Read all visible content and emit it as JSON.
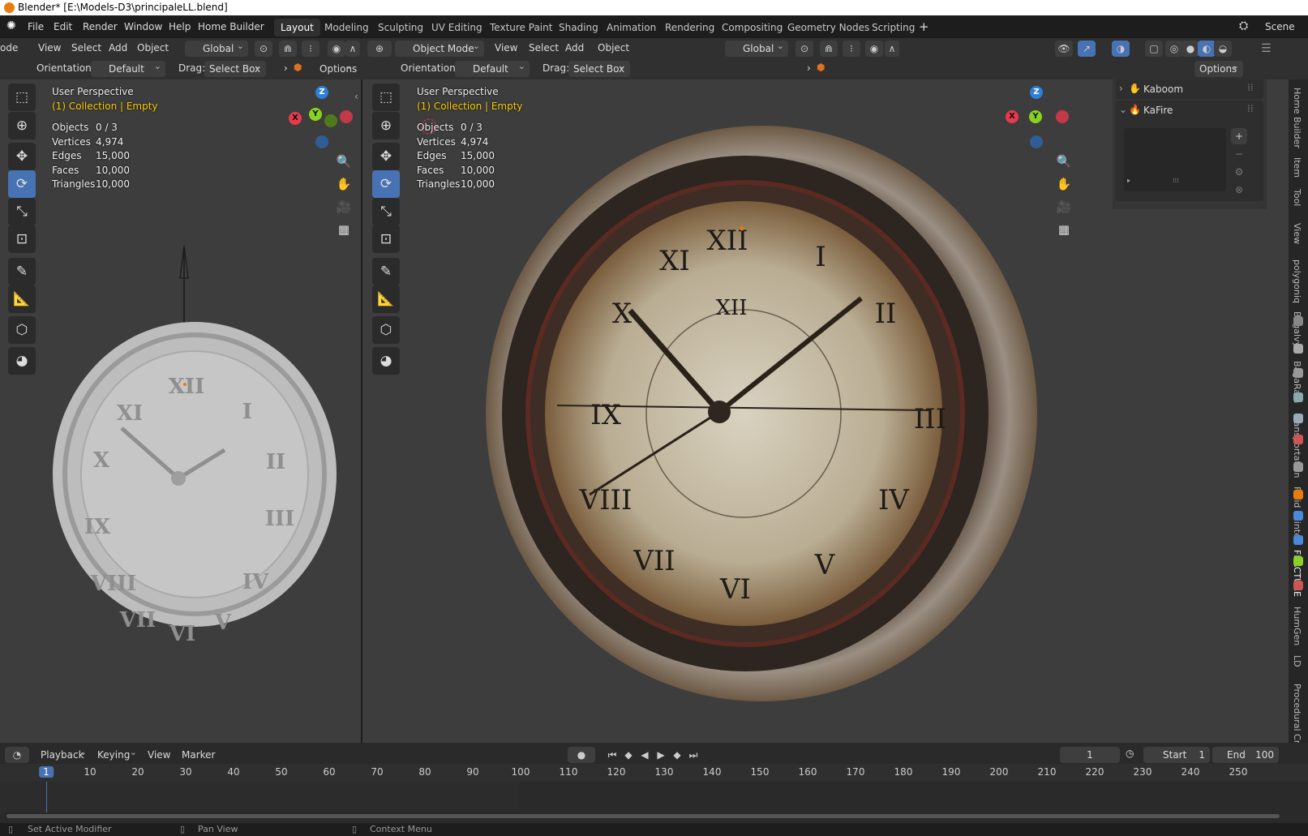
{
  "title": "Blender* [E:\\Models-D3\\principaleLL.blend]",
  "menu": [
    "File",
    "Edit",
    "Render",
    "Window",
    "Help",
    "Home Builder"
  ],
  "workspaces": [
    "Layout",
    "Modeling",
    "Sculpting",
    "UV Editing",
    "Texture Paint",
    "Shading",
    "Animation",
    "Rendering",
    "Compositing",
    "Geometry Nodes",
    "Scripting"
  ],
  "active_workspace": "Layout",
  "scene": "Scene",
  "left_header": {
    "mode": "ode",
    "items": [
      "View",
      "Select",
      "Add",
      "Object"
    ],
    "transform": "Global"
  },
  "right_header": {
    "mode": "Object Mode",
    "items": [
      "View",
      "Select",
      "Add",
      "Object"
    ],
    "transform": "Global",
    "options": "Options"
  },
  "subheader": {
    "orientation_label": "Orientation:",
    "orientation_value": "Default",
    "drag_label": "Drag:",
    "drag_value": "Select Box",
    "options": "Options"
  },
  "viewport": {
    "perspective": "User Perspective",
    "collection": "(1) Collection | Empty",
    "stats": [
      {
        "k": "Objects",
        "v": "0 / 3"
      },
      {
        "k": "Vertices",
        "v": "4,974"
      },
      {
        "k": "Edges",
        "v": "15,000"
      },
      {
        "k": "Faces",
        "v": "10,000"
      },
      {
        "k": "Triangles",
        "v": "10,000"
      }
    ],
    "axes": {
      "x": "X",
      "y": "Y",
      "z": "Z"
    }
  },
  "npanel": {
    "items": [
      "Kaboom",
      "KaFire"
    ]
  },
  "sidebar_tabs": [
    "Home Builder",
    "Item",
    "Tool",
    "View",
    "polygoniq",
    "Bagalvy",
    "BagaRain",
    "Transportation",
    "Fluid Painter",
    "FRACTURE",
    "HumGen",
    "LD",
    "Procedural Cro"
  ],
  "timeline": {
    "menus": [
      "Playback",
      "Keying",
      "View",
      "Marker"
    ],
    "current_frame": "1",
    "start_label": "Start",
    "start": "1",
    "end_label": "End",
    "end": "100",
    "ticks": [
      "1",
      "10",
      "20",
      "30",
      "40",
      "50",
      "60",
      "70",
      "80",
      "90",
      "100",
      "110",
      "120",
      "130",
      "140",
      "150",
      "160",
      "170",
      "180",
      "190",
      "200",
      "210",
      "220",
      "230",
      "240",
      "250"
    ]
  },
  "status": [
    "Set Active Modifier",
    "Pan View",
    "Context Menu"
  ],
  "colors": {
    "accent": "#4772b3",
    "x_axis": "#e83a4d",
    "y_axis": "#8ad221",
    "z_axis": "#2d7fd8",
    "yellow_text": "#ffd000"
  },
  "icons": {
    "select": "cursor-select-icon",
    "cursor": "3d-cursor-icon",
    "move": "move-icon",
    "rotate": "rotate-icon",
    "scale": "scale-icon",
    "transform": "transform-icon",
    "annotate": "annotate-icon",
    "measure": "measure-icon",
    "add_cube": "add-cube-icon",
    "shading": "shading-ball-icon"
  }
}
